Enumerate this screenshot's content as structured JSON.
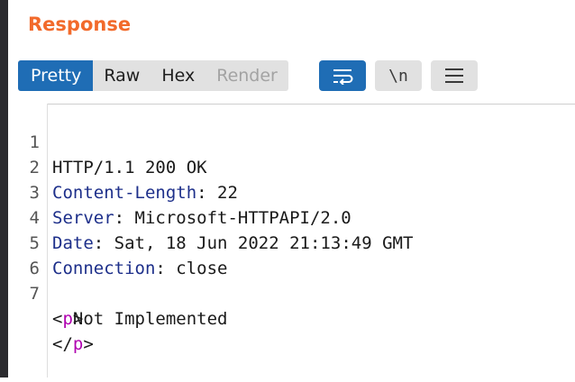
{
  "panel": {
    "title": "Response"
  },
  "tabs": [
    {
      "label": "Pretty",
      "active": true
    },
    {
      "label": "Raw",
      "active": false
    },
    {
      "label": "Hex",
      "active": false
    },
    {
      "label": "Render",
      "active": false,
      "disabled": true
    }
  ],
  "toolbar": {
    "wrap_icon": "wrap-lines-icon",
    "newline_label": "\\n",
    "menu_icon": "hamburger-menu-icon"
  },
  "colors": {
    "title": "#f26a2b",
    "accent": "#1f6db5",
    "header_name": "#1d2f8a",
    "html_tag": "#b000b0"
  },
  "editor": {
    "lines": [
      {
        "number": "1",
        "text": "HTTP/1.1 200 OK"
      },
      {
        "number": "2",
        "key": "Content-Length",
        "sep": ": ",
        "value": "22"
      },
      {
        "number": "3",
        "key": "Server",
        "sep": ": ",
        "value": "Microsoft-HTTPAPI/2.0"
      },
      {
        "number": "4",
        "key": "Date",
        "sep": ": ",
        "value": "Sat, 18 Jun 2022 21:13:49 GMT"
      },
      {
        "number": "5",
        "key": "Connection",
        "sep": ": ",
        "value": "close"
      },
      {
        "number": "6",
        "text": ""
      },
      {
        "number": "7",
        "open": "<",
        "tag": "p",
        "close": ">"
      },
      {
        "text": "  Not Implemented"
      },
      {
        "open": "</",
        "tag": "p",
        "close": ">"
      }
    ]
  }
}
